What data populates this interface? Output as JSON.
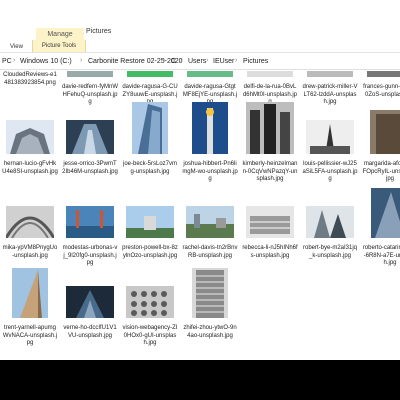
{
  "ribbon": {
    "manage_label": "Manage",
    "folder_label": "Pictures",
    "view_label": "View",
    "picture_tools_label": "Picture Tools"
  },
  "address": {
    "crumbs": [
      "PC",
      "Windows 10 (C:)",
      "Carbonite Restore 02-25-2020",
      "C",
      "Users",
      "IEUser",
      "Pictures"
    ]
  },
  "files": [
    {
      "name": "CloudedReviews-e1481383923854.png"
    },
    {
      "name": "davie-redfern-fyMnWHFehuQ-unsplash.jpg"
    },
    {
      "name": "davide-ragusa-G-CUZY8uuwE-unsplash.jpg"
    },
    {
      "name": "davide-ragusa-GtgtMF8EjYE-unsplash.jpg"
    },
    {
      "name": "delfi-de-la-rua-0BvLd6hMt0I-unsplash.jpg"
    },
    {
      "name": "drew-patrick-miller-VLT62-lzddA-unsplash.jpg"
    },
    {
      "name": "frances-gunn-9RlCh0ZoS-unsplash.jpg"
    },
    {
      "name": "hernan-lucio-gFvHkU4e8SI-unsplash.jpg"
    },
    {
      "name": "jesse-orrico-3PwmT2Ib46M-unsplash.jpg"
    },
    {
      "name": "joe-beck-5rsLoz7vmg-unsplash.jpg"
    },
    {
      "name": "joshua-hibbert-Pn6limgM-wo-unsplash.jpg"
    },
    {
      "name": "kimberly-heinzelmann-0CqVwNPazqY-unsplash.jpg"
    },
    {
      "name": "louis-pellissier-wJ25aSiL5FA-unsplash.jpg"
    },
    {
      "name": "margarida-afonso-5FOpcRyIL-unsplash.jpg"
    },
    {
      "name": "mika-ypVM8PnygUo-unsplash.jpg"
    },
    {
      "name": "modestas-urbonas-vj_9l20fg0-unsplash.jpg"
    },
    {
      "name": "preston-powell-bx-8zylnOzo-unsplash.jpg"
    },
    {
      "name": "rachel-davis-tn2rBnvRB-unsplash.jpg"
    },
    {
      "name": "rebecca-li-nJ5hINh6fs-unsplash.jpg"
    },
    {
      "name": "robert-bye-m2aI31jq_k-unsplash.jpg"
    },
    {
      "name": "roberto-catarinicchia-6R8N-a7E-unsplash.jpg"
    },
    {
      "name": "trent-yarnell-apumgWvNACA-unsplash.jpg"
    },
    {
      "name": "verne-ho-dccIfU1V1VU-unsplash.jpg"
    },
    {
      "name": "vision-webagency-ZI0HOx0-gUI-unsplash.jpg"
    },
    {
      "name": "zhifei-zhou-ytwO-9n4ao-unsplash.jpg"
    }
  ]
}
